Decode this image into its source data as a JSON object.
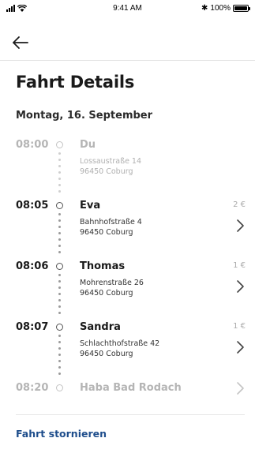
{
  "status_bar": {
    "time": "9:41 AM",
    "bluetooth": "✱",
    "battery_text": "100%",
    "battery_level": 1.0
  },
  "header": {
    "title": "Fahrt Details",
    "date": "Montag, 16. September"
  },
  "stops": [
    {
      "time": "08:00",
      "name": "Du",
      "street": "Lossaustraße 14",
      "city": "96450 Coburg",
      "price": "",
      "has_chevron": false,
      "muted": true
    },
    {
      "time": "08:05",
      "name": "Eva",
      "street": "Bahnhofstraße 4",
      "city": "96450 Coburg",
      "price": "2 €",
      "has_chevron": true,
      "muted": false
    },
    {
      "time": "08:06",
      "name": "Thomas",
      "street": "Mohrenstraße 26",
      "city": "96450 Coburg",
      "price": "1 €",
      "has_chevron": true,
      "muted": false
    },
    {
      "time": "08:07",
      "name": "Sandra",
      "street": "Schlachthofstraße 42",
      "city": "96450 Coburg",
      "price": "1 €",
      "has_chevron": true,
      "muted": false
    },
    {
      "time": "08:20",
      "name": "Haba Bad Rodach",
      "street": "",
      "city": "",
      "price": "",
      "has_chevron": true,
      "muted": true
    }
  ],
  "footer": {
    "cancel_label": "Fahrt stornieren"
  },
  "colors": {
    "accent": "#1f4e8c",
    "muted_text": "#b5b5b5"
  },
  "icons": {
    "back": "arrow-left-icon",
    "chevron": "chevron-right-icon"
  }
}
